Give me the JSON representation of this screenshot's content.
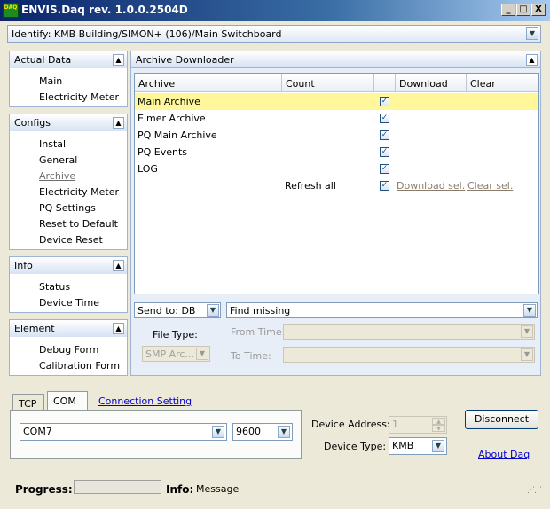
{
  "window": {
    "icon_text": "DAQ",
    "title": "ENVIS.Daq rev. 1.0.0.2504D",
    "controls": [
      "_",
      "□",
      "X"
    ]
  },
  "identify": {
    "value": "Identify: KMB Building/SIMON+  (106)/Main Switchboard"
  },
  "sidebar": {
    "groups": [
      {
        "title": "Actual Data",
        "items": [
          "Main",
          "Electricity Meter"
        ]
      },
      {
        "title": "Configs",
        "items": [
          "Install",
          "General",
          "Archive",
          "Electricity Meter",
          "PQ Settings",
          "Reset to Default",
          "Device Reset"
        ]
      },
      {
        "title": "Info",
        "items": [
          "Status",
          "Device Time"
        ]
      },
      {
        "title": "Element",
        "items": [
          "Debug Form",
          "Calibration Form"
        ]
      }
    ],
    "active_item": "Archive"
  },
  "archive": {
    "panel_title": "Archive Downloader",
    "columns": [
      "Archive",
      "Count",
      "",
      "Download",
      "Clear"
    ],
    "rows": [
      {
        "name": "Main Archive",
        "count": "",
        "checked": true,
        "download": "",
        "clear": ""
      },
      {
        "name": "Elmer Archive",
        "count": "",
        "checked": true,
        "download": "",
        "clear": ""
      },
      {
        "name": "PQ Main Archive",
        "count": "",
        "checked": true,
        "download": "",
        "clear": ""
      },
      {
        "name": "PQ Events",
        "count": "",
        "checked": true,
        "download": "",
        "clear": ""
      },
      {
        "name": "LOG",
        "count": "",
        "checked": true,
        "download": "",
        "clear": ""
      }
    ],
    "refresh_all": "Refresh all",
    "download_sel": "Download sel.",
    "clear_sel": "Clear sel.",
    "send_to": "Send to: DB",
    "find_mode": "Find missing",
    "file_type_label": "File Type:",
    "file_type_value": "SMP Arc...",
    "from_time_label": "From Time:",
    "to_time_label": "To Time:",
    "from_time_value": "",
    "to_time_value": ""
  },
  "connection": {
    "tabs": [
      "TCP",
      "COM"
    ],
    "active_tab": "COM",
    "setting_link": "Connection Setting",
    "port": "COM7",
    "baud": "9600",
    "device_address_label": "Device Address:",
    "device_address": "1",
    "device_type_label": "Device Type:",
    "device_type": "KMB",
    "disconnect_label": "Disconnect",
    "about_link": "About Daq"
  },
  "status": {
    "progress_label": "Progress:",
    "progress": 0,
    "info_label": "Info:",
    "info_text": "Message"
  },
  "colors": {
    "title_bar": "#0a246a",
    "selected_row": "#fff79a",
    "panel_border": "#9fb4d4",
    "link": "#0000cc"
  }
}
